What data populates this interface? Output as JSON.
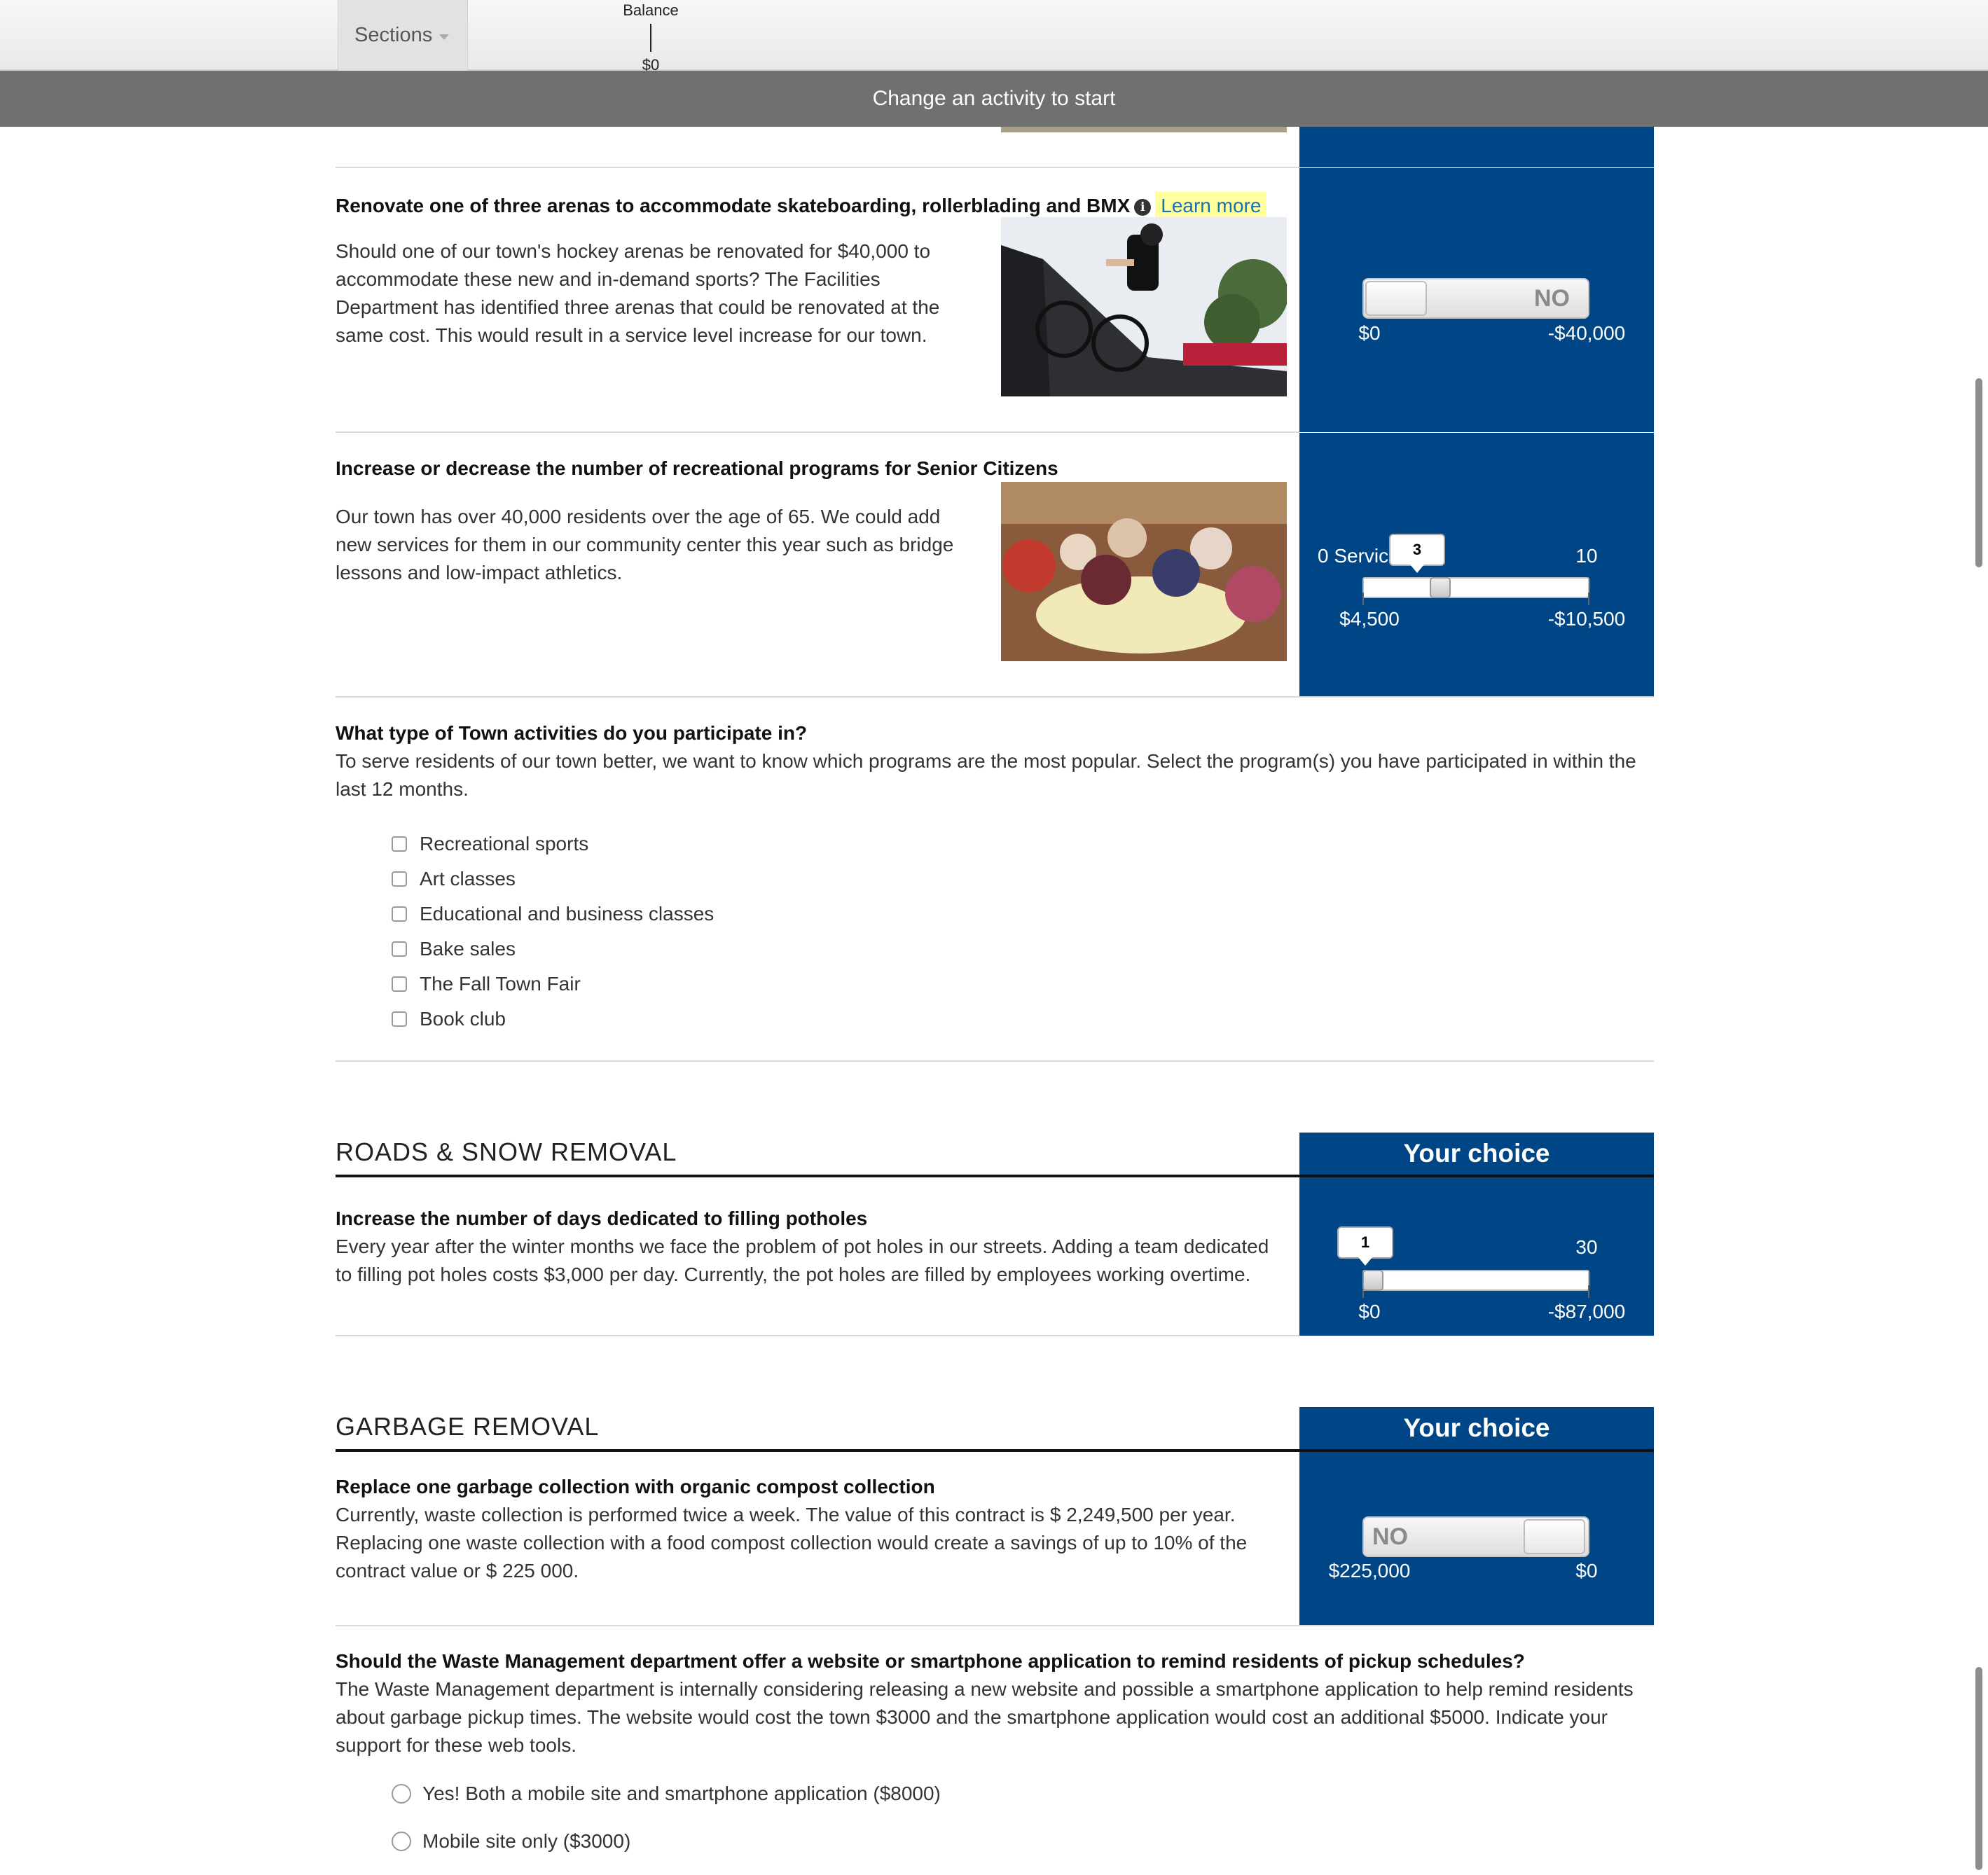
{
  "header": {
    "sections_label": "Sections",
    "balance_label": "Balance",
    "balance_value": "$0",
    "banner_text": "Change an activity to start"
  },
  "skate": {
    "title": "Renovate one of three arenas to accommodate skateboarding, rollerblading and BMX",
    "learn_more": "Learn more",
    "description": "Should one of our town's hockey arenas be renovated for $40,000 to accommodate these new and in-demand sports? The Facilities Department has identified three arenas that could be renovated at the same cost. This would result in a service level increase for our town.",
    "toggle_label": "NO",
    "left_value": "$0",
    "right_value": "-$40,000"
  },
  "seniors": {
    "title": "Increase or decrease the number of recreational programs for Senior Citizens",
    "description": "Our town has over 40,000 residents over the age of 65. We could add new services for them in our community center this year such as bridge lessons and low-impact athletics.",
    "min_label": "0 Services",
    "max_label": "10",
    "current": "3",
    "left_value": "$4,500",
    "right_value": "-$10,500"
  },
  "activities": {
    "title": "What type of Town activities do you participate in?",
    "description": "To serve residents of our town better, we want to know which programs are the most popular. Select the program(s) you have participated in within the last 12 months.",
    "options": [
      "Recreational sports",
      "Art classes",
      "Educational and business classes",
      "Bake sales",
      "The Fall Town Fair",
      "Book club"
    ]
  },
  "roads": {
    "section_title": "ROADS & SNOW REMOVAL",
    "your_choice": "Your choice",
    "title": "Increase the number of days dedicated to filling potholes",
    "description": "Every year after the winter months we face the problem of pot holes in our streets. Adding a team dedicated to filling pot holes costs $3,000 per day. Currently, the pot holes are filled by employees working overtime.",
    "max_label": "30",
    "current": "1",
    "left_value": "$0",
    "right_value": "-$87,000"
  },
  "garbage": {
    "section_title": "GARBAGE REMOVAL",
    "your_choice": "Your choice",
    "title": "Replace one garbage collection with organic compost collection",
    "description": "Currently, waste collection is performed twice a week. The value of this contract is $ 2,249,500 per year. Replacing one waste collection with a food compost collection would create a savings of up to 10% of the contract value or $ 225 000.",
    "toggle_label": "NO",
    "left_value": "$225,000",
    "right_value": "$0"
  },
  "waste_app": {
    "title": "Should the Waste Management department offer a website or smartphone application to remind residents of pickup schedules?",
    "description": "The Waste Management department is internally considering releasing a new website and possible a smartphone application to help remind residents about garbage pickup times. The website would cost the town $3000 and the smartphone application would cost an additional $5000. Indicate your support for these web tools.",
    "options": [
      "Yes! Both a mobile site and smartphone application ($8000)",
      "Mobile site only ($3000)"
    ]
  },
  "colors": {
    "panel_blue": "#004687",
    "banner_gray": "#707070",
    "learn_more_bg": "#ffff9c"
  }
}
